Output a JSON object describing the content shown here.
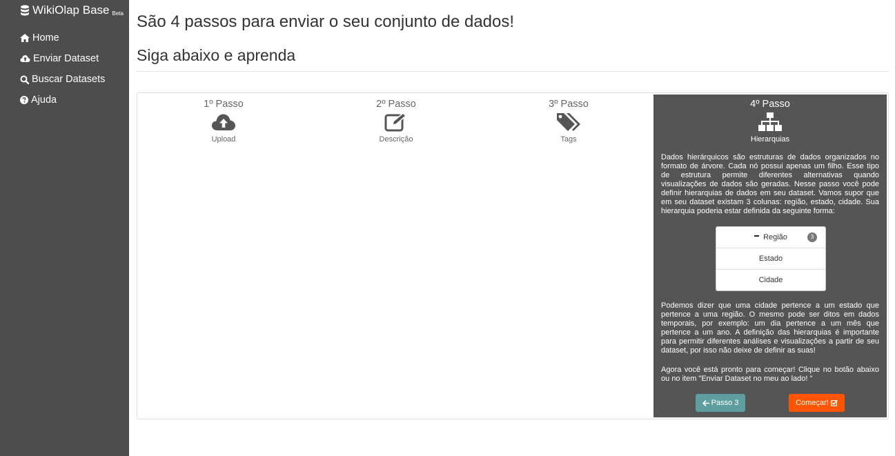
{
  "sidebar": {
    "brand": "WikiOlap Base",
    "brand_badge": "Beta",
    "brand_icon": "database-icon",
    "items": [
      {
        "label": "Home",
        "icon": "home-icon"
      },
      {
        "label": "Enviar Dataset",
        "icon": "cloud-upload-icon"
      },
      {
        "label": "Buscar Datasets",
        "icon": "search-icon"
      },
      {
        "label": "Ajuda",
        "icon": "question-circle-icon"
      }
    ]
  },
  "main": {
    "title": "São 4 passos para enviar o seu conjunto de dados!",
    "subtitle": "Siga abaixo e aprenda"
  },
  "steps": [
    {
      "title": "1º Passo",
      "label": "Upload",
      "icon": "cloud-upload-icon"
    },
    {
      "title": "2º Passo",
      "label": "Descrição",
      "icon": "edit-icon"
    },
    {
      "title": "3º Passo",
      "label": "Tags",
      "icon": "tags-icon"
    },
    {
      "title": "4º Passo",
      "label": "Hierarquias",
      "icon": "sitemap-icon"
    }
  ],
  "active_step": {
    "intro": "Dados hierárquicos são estruturas de dados organizados no formato de árvore. Cada nó possui apenas um filho. Esse tipo de estrutura permite diferentes alternativas quando visualizações de dados são geradas. Nesse passo você pode definir hierarquias de dados em seu dataset. Vamos supor que em seu dataset existam 3 colunas: região, estado, cidade. Sua hierarquia poderia estar definida da seguinte forma:",
    "tree": [
      {
        "label": "Região",
        "badge": "3"
      },
      {
        "label": "Estado"
      },
      {
        "label": "Cidade"
      }
    ],
    "explanation": "Podemos dizer que uma cidade pertence a um estado que pertence a uma região. O mesmo pode ser ditos em dados temporais, por exemplo: um dia pertence a um mês que pertence a um ano. A definição das hierarquias é importante para permitir diferentes análises e visualizações a partir de seu dataset, por isso não deixe de definir as suas!",
    "ready": "Agora você está pronto para começar! Clique no botão abaixo ou no item \"Enviar Dataset no meu ao lado! \"",
    "back_button": "Passo 3",
    "start_button": "Começar!"
  },
  "colors": {
    "sidebar_bg": "#4d4d4d",
    "active_step_bg": "#555555",
    "back_button": "#5f9ea0",
    "start_button": "#ff5500"
  }
}
